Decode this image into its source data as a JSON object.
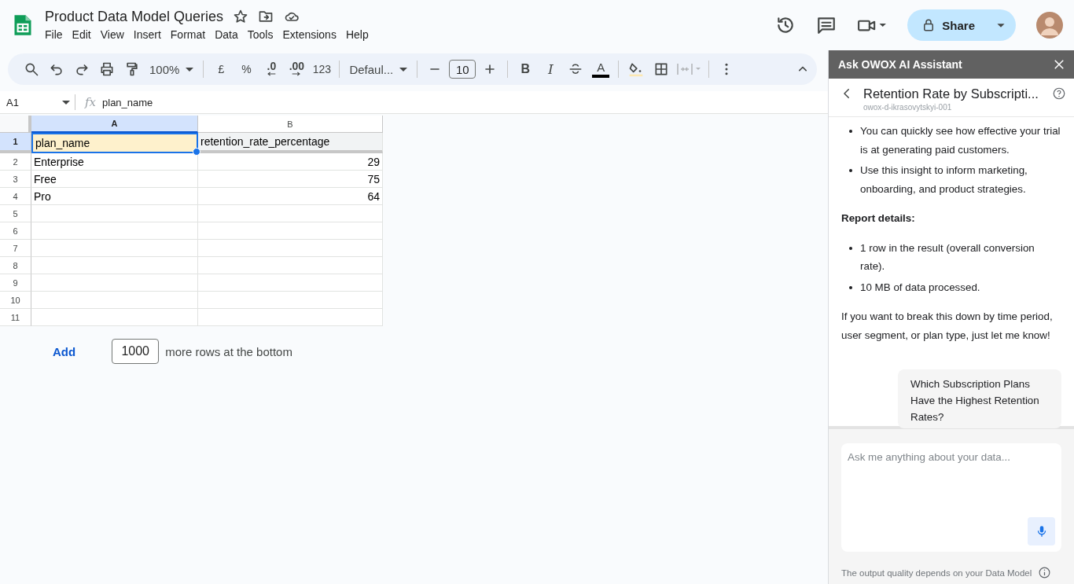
{
  "header": {
    "title": "Product Data Model Queries",
    "menus": [
      "File",
      "Edit",
      "View",
      "Insert",
      "Format",
      "Data",
      "Tools",
      "Extensions",
      "Help"
    ],
    "share_label": "Share"
  },
  "toolbar": {
    "items": [
      {
        "kind": "search"
      },
      {
        "kind": "undo"
      },
      {
        "kind": "redo"
      },
      {
        "kind": "print"
      },
      {
        "kind": "paint"
      },
      {
        "kind": "dropdown",
        "label": "100%"
      },
      {
        "kind": "sep"
      },
      {
        "kind": "text",
        "label": "£"
      },
      {
        "kind": "text",
        "label": "%"
      },
      {
        "kind": "decdown",
        "label": ".0"
      },
      {
        "kind": "decup",
        "label": ".00"
      },
      {
        "kind": "text",
        "label": "123"
      },
      {
        "kind": "sep"
      },
      {
        "kind": "dropdown",
        "label": "Defaul..."
      },
      {
        "kind": "sep"
      },
      {
        "kind": "minus"
      },
      {
        "kind": "size",
        "label": "10"
      },
      {
        "kind": "plus"
      },
      {
        "kind": "sep"
      },
      {
        "kind": "bold",
        "label": "B"
      },
      {
        "kind": "italic",
        "label": "I"
      },
      {
        "kind": "strike"
      },
      {
        "kind": "color",
        "label": "A"
      },
      {
        "kind": "sep"
      },
      {
        "kind": "fill"
      },
      {
        "kind": "borders"
      },
      {
        "kind": "merge"
      },
      {
        "kind": "sep"
      },
      {
        "kind": "more"
      }
    ]
  },
  "formula_bar": {
    "cell": "A1",
    "fx_label": "fx",
    "formula": "plan_name"
  },
  "grid": {
    "columns": [
      {
        "label": "A",
        "selected": true
      },
      {
        "label": "B",
        "selected": false
      }
    ],
    "rows": [
      {
        "number": "1",
        "selected": true,
        "frozen": true,
        "cells": [
          {
            "text": "plan_name",
            "kind": "text"
          },
          {
            "text": "retention_rate_percentage",
            "kind": "text"
          }
        ]
      },
      {
        "number": "2",
        "selected": false,
        "frozen": false,
        "cells": [
          {
            "text": "Enterprise",
            "kind": "text"
          },
          {
            "text": "29",
            "kind": "number"
          }
        ]
      },
      {
        "number": "3",
        "selected": false,
        "frozen": false,
        "cells": [
          {
            "text": "Free",
            "kind": "text"
          },
          {
            "text": "75",
            "kind": "number"
          }
        ]
      },
      {
        "number": "4",
        "selected": false,
        "frozen": false,
        "cells": [
          {
            "text": "Pro",
            "kind": "text"
          },
          {
            "text": "64",
            "kind": "number"
          }
        ]
      },
      {
        "number": "5",
        "selected": false,
        "frozen": false,
        "cells": []
      },
      {
        "number": "6",
        "selected": false,
        "frozen": false,
        "cells": []
      },
      {
        "number": "7",
        "selected": false,
        "frozen": false,
        "cells": []
      },
      {
        "number": "8",
        "selected": false,
        "frozen": false,
        "cells": []
      },
      {
        "number": "9",
        "selected": false,
        "frozen": false,
        "cells": []
      },
      {
        "number": "10",
        "selected": false,
        "frozen": false,
        "cells": []
      },
      {
        "number": "11",
        "selected": false,
        "frozen": false,
        "cells": []
      }
    ]
  },
  "add_rows": {
    "link": "Add",
    "count": "1000",
    "suffix": "more rows at the bottom"
  },
  "assistant": {
    "title": "Ask OWOX AI Assistant",
    "report_title": "Retention Rate by Subscripti...",
    "project": "owox-d-ikrasovytskyi-001",
    "messages": [
      {
        "kind": "bullet",
        "text": "You can quickly see how effective your trial is at generating paid customers."
      },
      {
        "kind": "bullet",
        "text": "Use this insight to inform marketing, onboarding, and product strategies."
      },
      {
        "kind": "heading",
        "text": "Report details:"
      },
      {
        "kind": "bullet",
        "text": "1 row in the result (overall conversion rate)."
      },
      {
        "kind": "bullet",
        "text": "10 MB of data processed."
      },
      {
        "kind": "paragraph",
        "text": "If you want to break this down by time period, user segment, or plan type, just let me know!"
      },
      {
        "kind": "user",
        "text": "Which Subscription Plans Have the Highest Retention Rates?"
      }
    ],
    "input": {
      "placeholder": "Ask me anything about your data..."
    },
    "footer": "The output quality depends on your Data Model"
  }
}
